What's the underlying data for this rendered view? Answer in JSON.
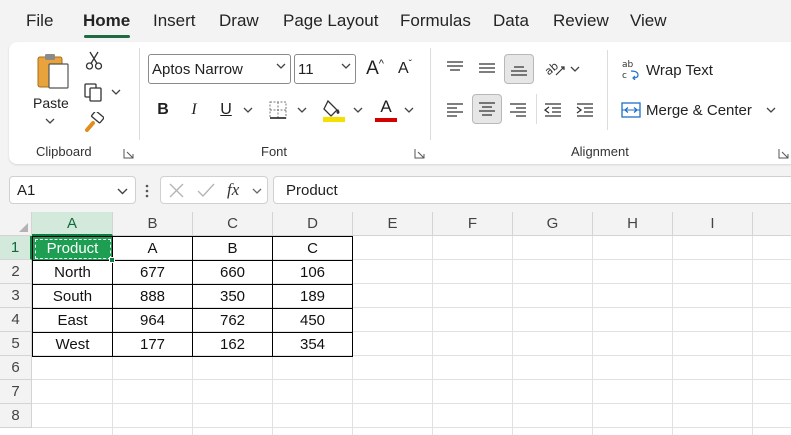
{
  "menu": {
    "tabs": [
      "File",
      "Home",
      "Insert",
      "Draw",
      "Page Layout",
      "Formulas",
      "Data",
      "Review",
      "View"
    ],
    "active": "Home"
  },
  "ribbon": {
    "clipboard": {
      "paste_label": "Paste",
      "group_label": "Clipboard"
    },
    "font": {
      "font_name": "Aptos Narrow",
      "font_size": "11",
      "grow_label": "A",
      "shrink_label": "A",
      "bold_label": "B",
      "italic_label": "I",
      "underline_label": "U",
      "font_color_label": "A",
      "group_label": "Font",
      "highlight_color": "#f5e000",
      "font_color": "#d40000"
    },
    "alignment": {
      "wrap_text_label": "Wrap Text",
      "merge_center_label": "Merge & Center",
      "group_label": "Alignment"
    }
  },
  "formula_bar": {
    "name_box": "A1",
    "fx_label": "fx",
    "value": "Product"
  },
  "grid": {
    "columns": [
      "A",
      "B",
      "C",
      "D",
      "E",
      "F",
      "G",
      "H",
      "I"
    ],
    "rows": [
      "1",
      "2",
      "3",
      "4",
      "5",
      "6",
      "7",
      "8"
    ],
    "selected_column": "A",
    "selected_row": "1",
    "accent_color": "#107c41"
  },
  "table": {
    "header": [
      "Product",
      "A",
      "B",
      "C"
    ],
    "rows": [
      [
        "North",
        "677",
        "660",
        "106"
      ],
      [
        "South",
        "888",
        "350",
        "189"
      ],
      [
        "East",
        "964",
        "762",
        "450"
      ],
      [
        "West",
        "177",
        "162",
        "354"
      ]
    ]
  }
}
